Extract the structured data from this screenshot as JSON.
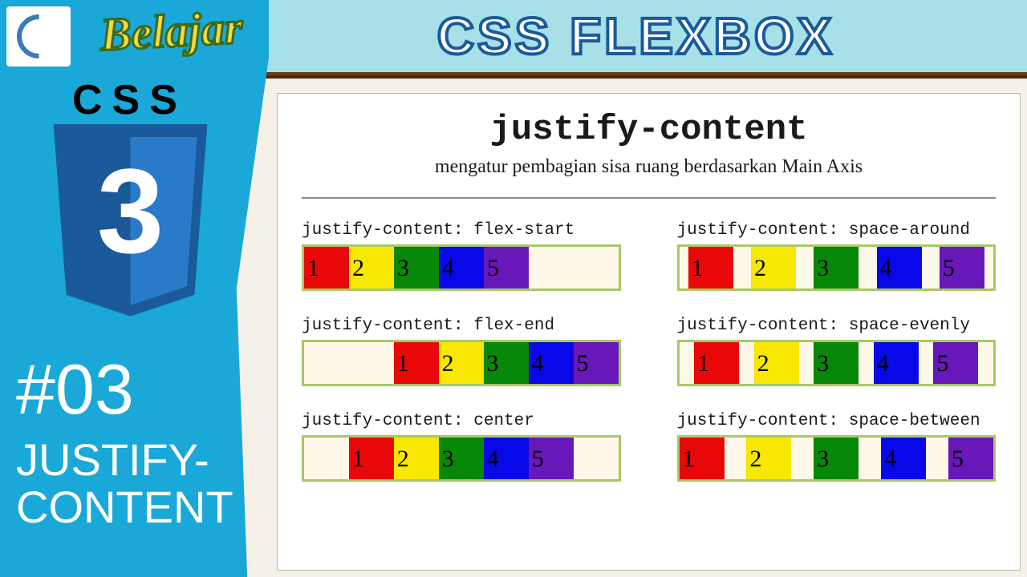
{
  "header": {
    "belajar": "Belajar",
    "title": "CSS FLEXBOX",
    "css_label": "CSS",
    "shield_number": "3"
  },
  "episode": {
    "number": "#03",
    "title_line1": "JUSTIFY-",
    "title_line2": "CONTENT"
  },
  "slide": {
    "heading": "justify-content",
    "subheading": "mengatur pembagian sisa ruang berdasarkan Main Axis"
  },
  "boxes": [
    "1",
    "2",
    "3",
    "4",
    "5"
  ],
  "examples": [
    {
      "label": "justify-content: flex-start",
      "cls": "js-flex-start"
    },
    {
      "label": "justify-content: space-around",
      "cls": "js-space-around"
    },
    {
      "label": "justify-content: flex-end",
      "cls": "js-flex-end"
    },
    {
      "label": "justify-content: space-evenly",
      "cls": "js-space-evenly"
    },
    {
      "label": "justify-content: center",
      "cls": "js-center"
    },
    {
      "label": "justify-content: space-between",
      "cls": "js-space-between"
    }
  ]
}
